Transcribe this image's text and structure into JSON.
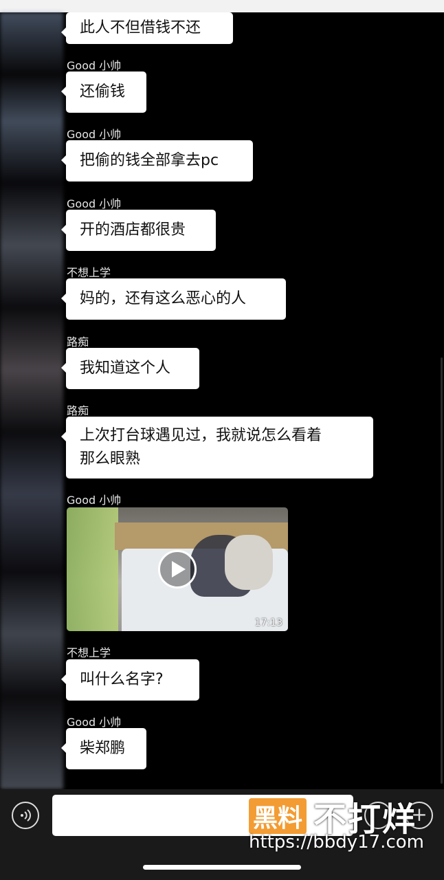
{
  "messages": [
    {
      "sender": "",
      "text": "此人不但借钱不还"
    },
    {
      "sender": "Good 小帅",
      "text": "还偷钱"
    },
    {
      "sender": "Good 小帅",
      "text": "把偷的钱全部拿去pc"
    },
    {
      "sender": "Good 小帅",
      "text": "开的酒店都很贵"
    },
    {
      "sender": "不想上学",
      "text": "妈的，还有这么恶心的人"
    },
    {
      "sender": "路痴",
      "text": "我知道这个人"
    },
    {
      "sender": "路痴",
      "text_line1": "上次打台球遇见过，我就说怎么看着",
      "text_line2": "那么眼熟"
    },
    {
      "sender": "Good 小帅",
      "video_duration": "17:13"
    },
    {
      "sender": "不想上学",
      "text": "叫什么名字?"
    },
    {
      "sender": "Good 小帅",
      "text": "柴郑鹏"
    }
  ],
  "watermark": {
    "brand": "黑料",
    "text": "不打烊",
    "url": "https://bbdy17.com"
  },
  "icons": {
    "voice": "voice-icon",
    "emoji": "emoji-icon",
    "plus": "plus-icon",
    "play": "play-icon"
  }
}
